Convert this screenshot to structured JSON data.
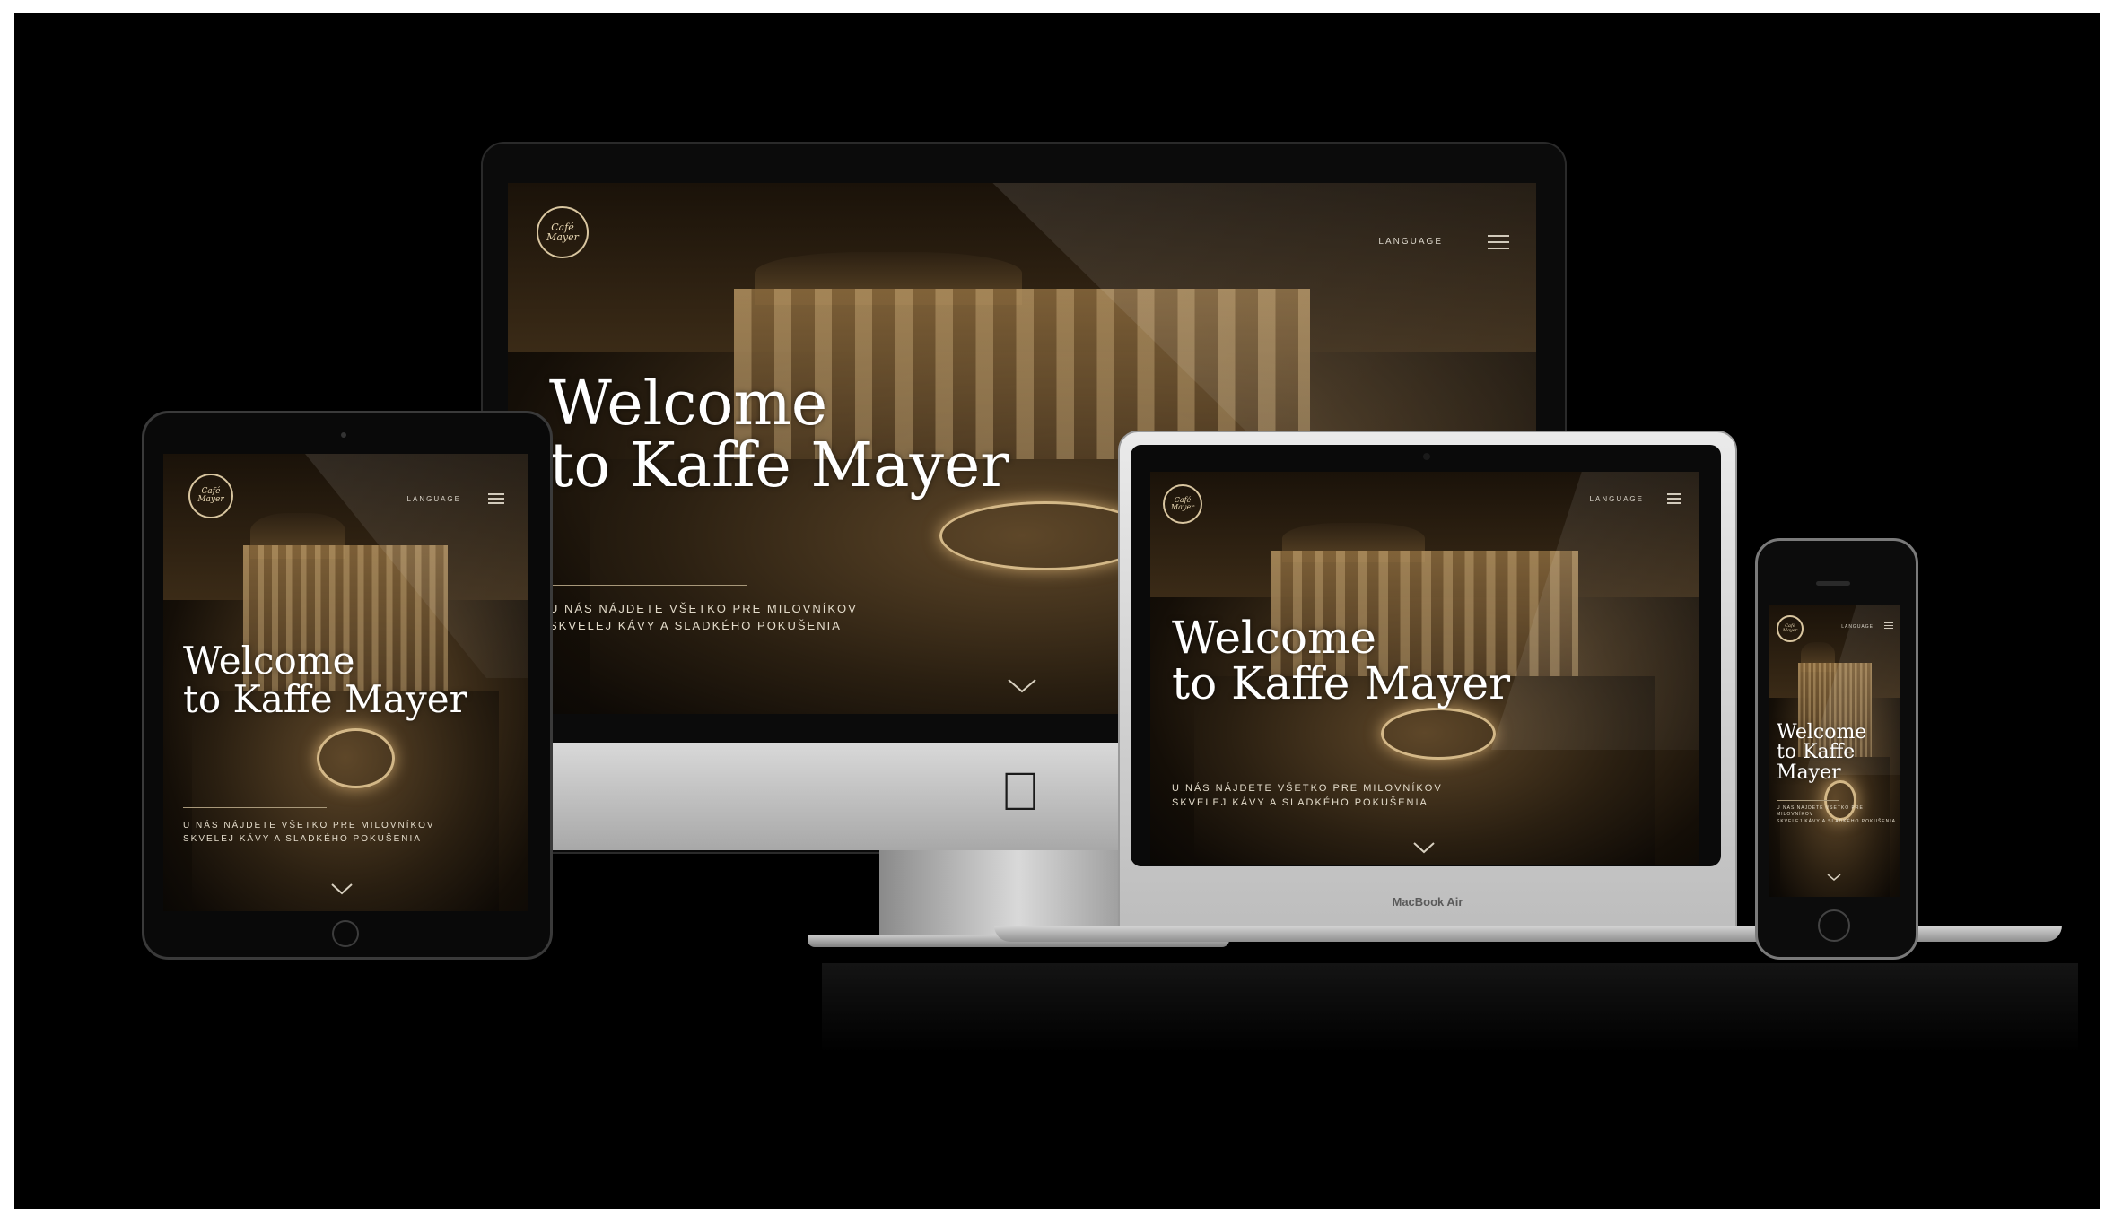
{
  "site": {
    "logo_text": "Café Mayer",
    "language_label": "LANGUAGE",
    "welcome_title": "Welcome\nto Kaffe Mayer",
    "tagline": "U NÁS NÁJDETE VŠETKO PRE MILOVNÍKOV\nSKVELEJ  KÁVY A SLADKÉHO POKUŠENIA"
  },
  "devices": {
    "macbook_label": "MacBook Air"
  },
  "colors": {
    "background": "#000000",
    "accent_sepia": "#6b5231",
    "text_light": "#ffffff"
  },
  "icons": {
    "menu": "hamburger-icon",
    "scroll": "chevron-down-icon",
    "brand": "apple-logo-icon"
  }
}
